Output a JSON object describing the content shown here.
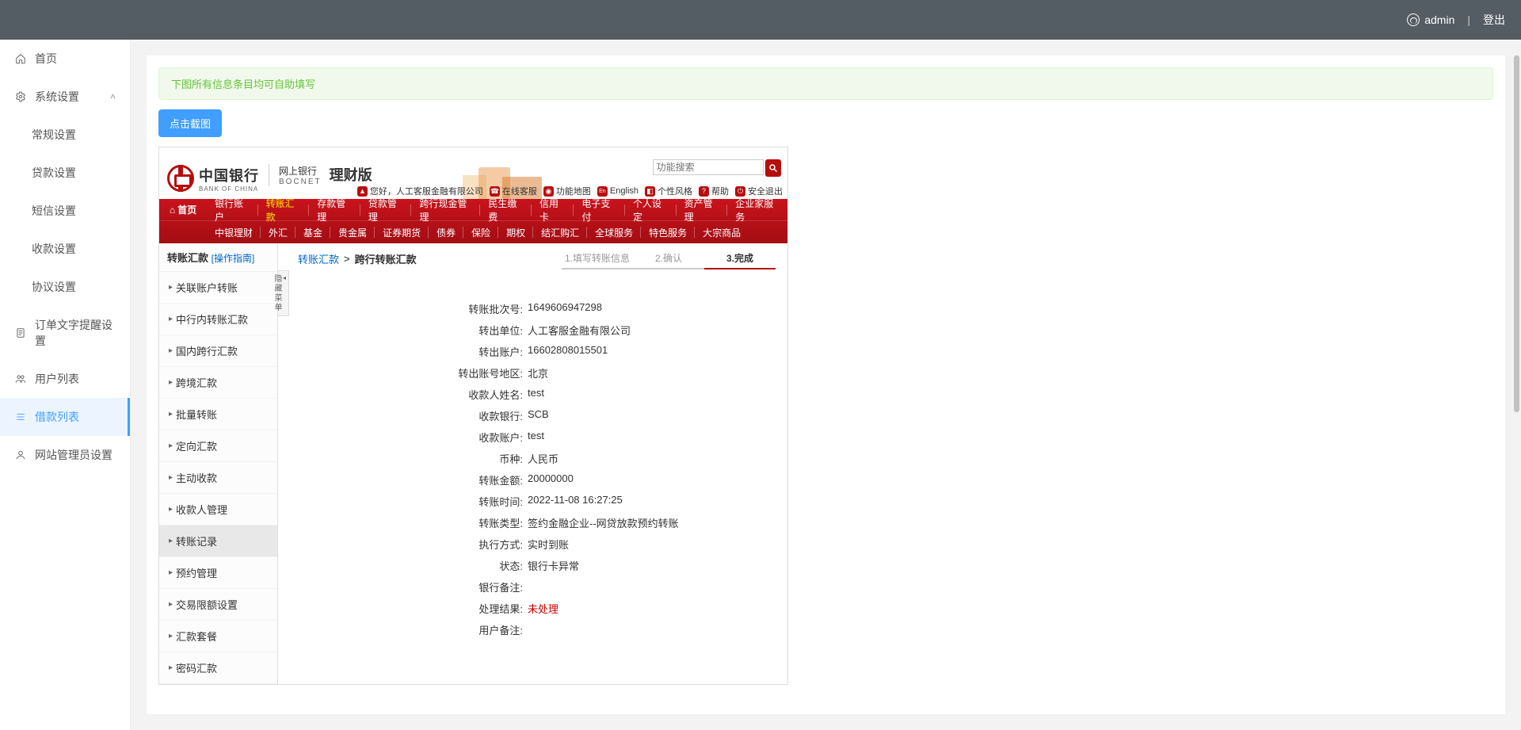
{
  "topbar": {
    "username": "admin",
    "logout": "登出"
  },
  "sidebar": {
    "home": "首页",
    "system_settings": "系统设置",
    "subs": {
      "general": "常规设置",
      "loan": "贷款设置",
      "sms": "短信设置",
      "collection": "收款设置",
      "agreement": "协议设置"
    },
    "order_text": "订单文字提醒设置",
    "users": "用户列表",
    "loans": "借款列表",
    "admins": "网站管理员设置"
  },
  "alert": "下图所有信息条目均可自助填写",
  "screenshot_btn": "点击截图",
  "bank": {
    "name_cn": "中国银行",
    "name_en": "BANK OF CHINA",
    "bocnet1": "网上银行",
    "bocnet2": "BOCNET",
    "version": "理财版",
    "search_placeholder": "功能搜索",
    "greeting": "您好，人工客服金融有限公司",
    "tb": {
      "online_cs": "在线客服",
      "map": "功能地图",
      "english": "English",
      "style": "个性风格",
      "help": "帮助",
      "logout": "安全退出"
    },
    "nav_home": "首页",
    "nav1": [
      "银行账户",
      "转账汇款",
      "存款管理",
      "贷款管理",
      "跨行现金管理",
      "民生缴费",
      "信用卡",
      "电子支付",
      "个人设定",
      "资产管理",
      "企业家服务"
    ],
    "nav1_active_index": 1,
    "nav2": [
      "中银理财",
      "外汇",
      "基金",
      "贵金属",
      "证券期货",
      "债券",
      "保险",
      "期权",
      "结汇购汇",
      "全球服务",
      "特色服务",
      "大宗商品"
    ]
  },
  "subsb": {
    "title": "转账汇款",
    "guide": "[操作指南]",
    "items": [
      "关联账户转账",
      "中行内转账汇款",
      "国内跨行汇款",
      "跨境汇款",
      "批量转账",
      "定向汇款",
      "主动收款",
      "收款人管理",
      "转账记录",
      "预约管理",
      "交易限额设置",
      "汇款套餐",
      "密码汇款"
    ],
    "selected_index": 8,
    "hide_menu": "隐藏菜单"
  },
  "bc": {
    "a": "转账汇款",
    "b": "跨行转账汇款"
  },
  "steps": {
    "s1": "1.填写转账信息",
    "s2": "2.确认",
    "s3": "3.完成"
  },
  "detail": {
    "rows": [
      {
        "label": "转账批次号:",
        "value": "1649606947298"
      },
      {
        "label": "转出单位:",
        "value": "人工客服金融有限公司"
      },
      {
        "label": "转出账户:",
        "value": "16602808015501"
      },
      {
        "label": "转出账号地区:",
        "value": "北京"
      },
      {
        "label": "收款人姓名:",
        "value": "test"
      },
      {
        "label": "收款银行:",
        "value": "SCB"
      },
      {
        "label": "收款账户:",
        "value": "test"
      },
      {
        "label": "币种:",
        "value": "人民币"
      },
      {
        "label": "转账金额:",
        "value": "20000000"
      },
      {
        "label": "转账时间:",
        "value": "2022-11-08 16:27:25"
      },
      {
        "label": "转账类型:",
        "value": "签约金融企业--网贷放款预约转账"
      },
      {
        "label": "执行方式:",
        "value": "实时到账"
      },
      {
        "label": "状态:",
        "value": "银行卡异常"
      },
      {
        "label": "银行备注:",
        "value": ""
      },
      {
        "label": "处理结果:",
        "value": "未处理",
        "red": true
      },
      {
        "label": "用户备注:",
        "value": ""
      }
    ]
  }
}
